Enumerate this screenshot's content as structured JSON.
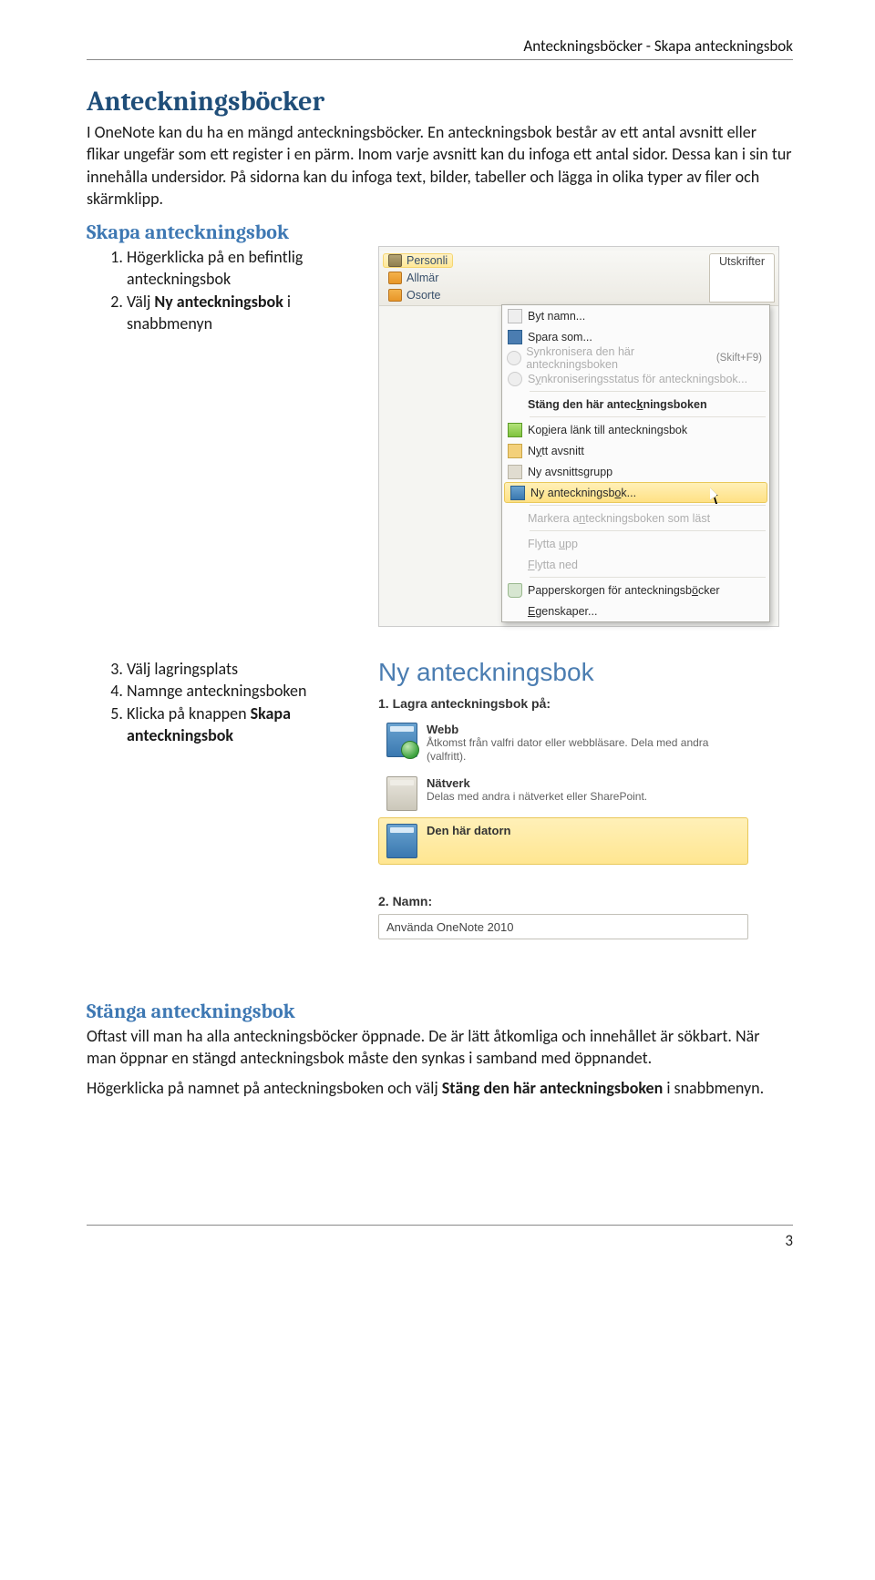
{
  "header": {
    "path": "Anteckningsböcker - Skapa anteckningsbok"
  },
  "h1": "Anteckningsböcker",
  "intro1": "I OneNote kan du ha en mängd anteckningsböcker. En anteckningsbok består av ett antal avsnitt eller flikar ungefär som ett register i en pärm. Inom varje avsnitt kan du infoga ett antal sidor. Dessa kan i sin tur innehålla undersidor. På sidorna kan du infoga text, bilder, tabeller och lägga in olika typer av filer och skärmklipp.",
  "h2a": "Skapa anteckningsbok",
  "steps1": [
    "Högerklicka på en befintlig anteckningsbok",
    "Välj "
  ],
  "steps1_bold": "Ny anteckningsbok",
  "steps1_after": " i snabbmenyn",
  "steps2": [
    "Välj lagringsplats",
    "Namnge anteckningsboken",
    "Klicka på knappen "
  ],
  "steps2_bold": "Skapa anteckningsbok",
  "h2b": "Stänga anteckningsbok",
  "close1a": "Oftast vill man ha alla anteckningsböcker öppnade. De är lätt åtkomliga och innehållet är sökbart. När man öppnar en stängd anteckningsbok måste den synkas i samband med öppnandet.",
  "close2a": "Högerklicka på namnet på anteckningsboken och välj ",
  "close2b": "Stäng den här anteckningsboken",
  "close2c": " i snabbmenyn.",
  "page_num": "3",
  "shot1": {
    "header_left": [
      "Personli",
      "Allmär",
      "Osorte"
    ],
    "tab_right": "Utskrifter",
    "menu": [
      {
        "label": "Byt namn...",
        "icon": "rename"
      },
      {
        "label": "Spara som...",
        "icon": "saveas"
      },
      {
        "label": "Synkronisera den här anteckningsboken  (Skift+F9)",
        "icon": "sync",
        "disabled": true
      },
      {
        "label": "Synkroniseringsstatus för anteckningsbok...",
        "icon": "syncstat",
        "disabled": true
      },
      {
        "sep": true
      },
      {
        "label": "Stäng den här anteckningsboken",
        "icon": "",
        "bold": true
      },
      {
        "sep": true
      },
      {
        "label": "Kopiera länk till anteckningsbok",
        "icon": "link"
      },
      {
        "label": "Nytt avsnitt",
        "icon": "newsec"
      },
      {
        "label": "Ny avsnittsgrupp",
        "icon": "newgrp"
      },
      {
        "label": "Ny anteckningsbok...",
        "icon": "newnb",
        "highlight": true
      },
      {
        "sep": true
      },
      {
        "label": "Markera anteckningsboken som läst",
        "disabled": true
      },
      {
        "sep": true
      },
      {
        "label": "Flytta upp",
        "disabled": true
      },
      {
        "label": "Flytta ned",
        "disabled": true
      },
      {
        "sep": true
      },
      {
        "label": "Papperskorgen för anteckningsböcker",
        "icon": "bin"
      },
      {
        "label": "Egenskaper..."
      }
    ]
  },
  "shot2": {
    "title": "Ny anteckningsbok",
    "step1": "1. Lagra anteckningsbok på:",
    "opts": [
      {
        "name": "Webb",
        "desc": "Åtkomst från valfri dator eller webbläsare. Dela med andra (valfritt).",
        "ic": "globe"
      },
      {
        "name": "Nätverk",
        "desc": "Delas med andra i nätverket eller SharePoint.",
        "ic": "net"
      },
      {
        "name": "Den här datorn",
        "desc": "",
        "ic": "pc",
        "sel": true
      }
    ],
    "step2": "2. Namn:",
    "name_value": "Använda OneNote 2010"
  }
}
